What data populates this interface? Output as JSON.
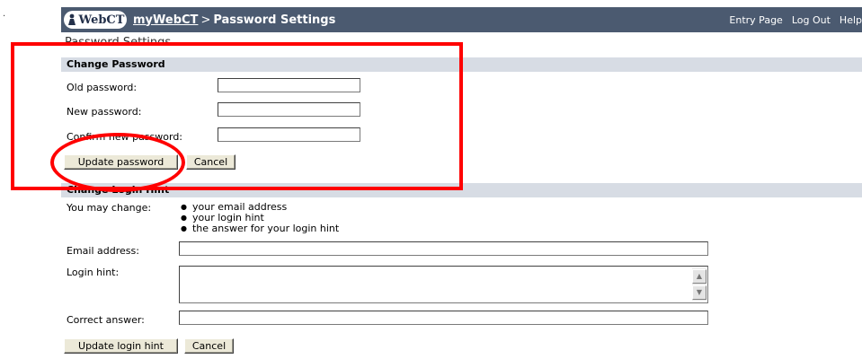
{
  "header": {
    "logo_text": "WebCT",
    "breadcrumb_link": "myWebCT",
    "breadcrumb_sep": ">",
    "breadcrumb_current": "Password Settings",
    "nav": [
      "Entry Page",
      "Log Out",
      "Help"
    ]
  },
  "page_title": "Password Settings",
  "change_password": {
    "heading": "Change Password",
    "old_label": "Old password:",
    "new_label": "New password:",
    "confirm_label": "Confirm new password:",
    "update_button": "Update password",
    "cancel_button": "Cancel"
  },
  "login_hint": {
    "heading": "Change Login Hint",
    "intro": "You may change:",
    "items": [
      "your email address",
      "your login hint",
      "the answer for your login hint"
    ],
    "email_label": "Email address:",
    "hint_label": "Login hint:",
    "answer_label": "Correct answer:",
    "update_button": "Update login hint",
    "cancel_button": "Cancel"
  },
  "annotation_colors": {
    "highlight": "#ff0000",
    "topbar": "#4b5a70",
    "section_bar": "#d7dce4"
  }
}
